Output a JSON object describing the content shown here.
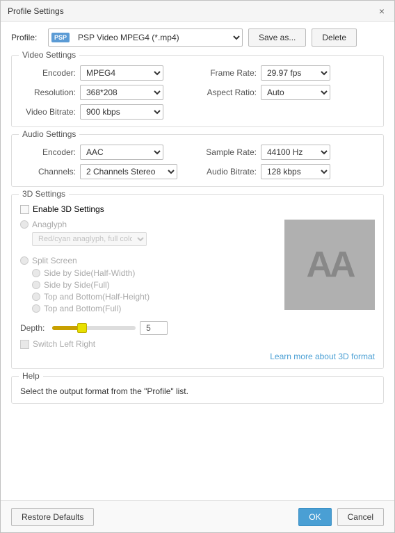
{
  "dialog": {
    "title": "Profile Settings",
    "close_label": "×"
  },
  "profile": {
    "label": "Profile:",
    "badge": "PSP",
    "value": "PSP Video MPEG4 (*.mp4)",
    "save_as_label": "Save as...",
    "delete_label": "Delete"
  },
  "video_settings": {
    "section_title": "Video Settings",
    "encoder_label": "Encoder:",
    "encoder_value": "MPEG4",
    "frame_rate_label": "Frame Rate:",
    "frame_rate_value": "29.97 fps",
    "resolution_label": "Resolution:",
    "resolution_value": "368*208",
    "aspect_ratio_label": "Aspect Ratio:",
    "aspect_ratio_value": "Auto",
    "video_bitrate_label": "Video Bitrate:",
    "video_bitrate_value": "900 kbps"
  },
  "audio_settings": {
    "section_title": "Audio Settings",
    "encoder_label": "Encoder:",
    "encoder_value": "AAC",
    "sample_rate_label": "Sample Rate:",
    "sample_rate_value": "44100 Hz",
    "channels_label": "Channels:",
    "channels_value": "2 Channels Stereo",
    "audio_bitrate_label": "Audio Bitrate:",
    "audio_bitrate_value": "128 kbps"
  },
  "three_d_settings": {
    "section_title": "3D Settings",
    "enable_label": "Enable 3D Settings",
    "anaglyph_label": "Anaglyph",
    "anaglyph_option": "Red/cyan anaglyph, full color",
    "split_screen_label": "Split Screen",
    "side_by_side_half_label": "Side by Side(Half-Width)",
    "side_by_side_full_label": "Side by Side(Full)",
    "top_bottom_half_label": "Top and Bottom(Half-Height)",
    "top_bottom_full_label": "Top and Bottom(Full)",
    "depth_label": "Depth:",
    "depth_value": "5",
    "switch_label": "Switch Left Right",
    "learn_more_label": "Learn more about 3D format",
    "preview_text": "AA"
  },
  "help": {
    "section_title": "Help",
    "help_text": "Select the output format from the \"Profile\" list."
  },
  "footer": {
    "restore_label": "Restore Defaults",
    "ok_label": "OK",
    "cancel_label": "Cancel"
  }
}
